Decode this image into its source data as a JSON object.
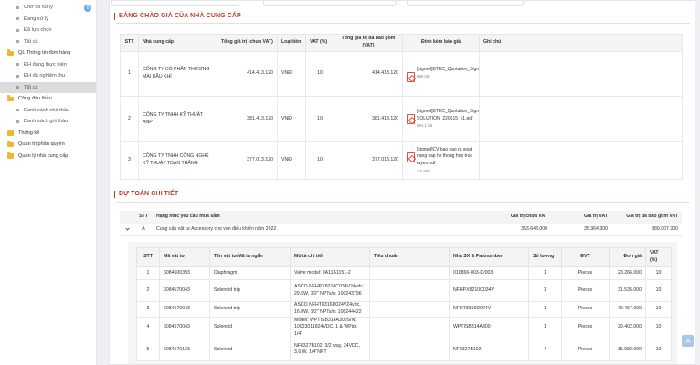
{
  "sidebar": {
    "items": [
      {
        "label": "Chờ tôi xử lý",
        "level": "sub",
        "badge": "0"
      },
      {
        "label": "Đang xử lý",
        "level": "sub"
      },
      {
        "label": "Đã lựa chọn",
        "level": "sub"
      },
      {
        "label": "Tất cả",
        "level": "sub"
      },
      {
        "label": "QL Thông tin đơn hàng",
        "level": "folder"
      },
      {
        "label": "ĐH đang thực hiện",
        "level": "sub"
      },
      {
        "label": "ĐH đã nghiệm thu",
        "level": "sub"
      },
      {
        "label": "Tất cả",
        "level": "sub",
        "active": true
      },
      {
        "label": "Công đấu thầu",
        "level": "folder"
      },
      {
        "label": "Danh sách nhà thầu",
        "level": "sub"
      },
      {
        "label": "Danh sách gói thầu",
        "level": "sub"
      },
      {
        "label": "Thống kê",
        "level": "folder"
      },
      {
        "label": "Quản trị phân quyền",
        "level": "folder"
      },
      {
        "label": "Quản lý nhà cung cấp",
        "level": "folder"
      }
    ]
  },
  "quotes": {
    "title": "BẢNG CHÀO GIÁ CỦA NHÀ CUNG CẤP",
    "headers": [
      "STT",
      "Nhà cung cấp",
      "Tổng giá trị (chưa VAT)",
      "Loại tiền",
      "VAT (%)",
      "Tổng giá trị đã bao gồm (VAT)",
      "Đính kèm báo giá",
      "Ghi chú"
    ],
    "rows": [
      {
        "stt": "1",
        "supplier": "CÔNG TY CỔ PHẦN THƯƠNG MẠI DẦU KHÍ",
        "total": "414.413.120",
        "currency": "VNĐ",
        "vat": "10",
        "total_vat": "414.413.120",
        "file": "[signed]BTEC_Quotation_Signflow_OnPrimes_AEONMALL_220615_v1.pdf",
        "size": "696 kB",
        "note": ""
      },
      {
        "stt": "2",
        "supplier": "CÔNG TY TNHH KỸ THUẬT ANP",
        "total": "381.413.120",
        "currency": "VNĐ",
        "vat": "10",
        "total_vat": "381.413.120",
        "file": "[signed]BTEC_Quotation_Signflow_OnPrimes_GENE SOLUTION_220615_v1.pdf",
        "size": "694.1 kB",
        "note": ""
      },
      {
        "stt": "3",
        "supplier": "CÔNG TY TNHH CÔNG NGHỆ KỸ THUẬT TOÀN THẮNG",
        "total": "377.013.120",
        "currency": "VNĐ",
        "vat": "10",
        "total_vat": "377.013.120",
        "file": "[signed]CV bao cao ra soat nang cap he thong hop truc tuyen.pdf",
        "size": "1.5 MB",
        "note": ""
      }
    ]
  },
  "estimate": {
    "title": "DỰ TOÁN CHI TIẾT",
    "headers": [
      "STT",
      "Hạng mục yêu cầu mua sắm",
      "Giá trị chưa VAT",
      "Giá trị VAT",
      "Giá trị đã bao gồm VAT"
    ],
    "group": {
      "stt": "A",
      "name": "Cung cấp vật tư Accessory cho van điều khiển năm 2022",
      "value": "353.643.000",
      "vat": "35.364.300",
      "total": "389.007.300"
    },
    "item_headers": [
      "STT",
      "Mã vật tư",
      "Tên vật tư/Mã tả ngắn",
      "Mô tả chi tiết",
      "Tiêu chuẩn",
      "Nhà SX & Partnumber",
      "Số lượng",
      "ĐVT",
      "Đơn giá",
      "VAT (%)"
    ],
    "items": [
      {
        "stt": "1",
        "code": "6084500393",
        "name": "Diaphragm",
        "desc": "Valve model: JA11A1151-2",
        "std": "",
        "maker": "010866-003-D/003",
        "qty": "1",
        "unit": "Pieces",
        "price": "23.266.000",
        "vat": "10"
      },
      {
        "stt": "2",
        "code": "6084570043",
        "name": "Solenoid trip",
        "desc": "ASCO NFHPX8210C034V24vdc, 29.5W, 1/2\" NPTs/n: 100243796",
        "std": "",
        "maker": "NFHPX8210C034V",
        "qty": "1",
        "unit": "Pieces",
        "price": "31.535.000",
        "vat": "10"
      },
      {
        "stt": "3",
        "code": "6084570043",
        "name": "Solenoid trip",
        "desc": "ASCO NFHT8316D024V24vdc, 16.8W, 1/2\" NPTs/n: 100244422",
        "std": "",
        "maker": "NFHT8316D024V",
        "qty": "1",
        "unit": "Pieces",
        "price": "49.467.000",
        "vat": "10"
      },
      {
        "stt": "4",
        "code": "6084570043",
        "name": "Solenoid",
        "desc": "Model: WPTISB314A300S/N: 10023011824VDC, 1 & WPipr. 1/4\"",
        "std": "",
        "maker": "WPTISB314A300",
        "qty": "1",
        "unit": "Pieces",
        "price": "29.402.000",
        "vat": "10"
      },
      {
        "stt": "5",
        "code": "6084570133",
        "name": "Solenoid",
        "desc": "NF8327B102, 3/2 way, 24VDC, 3,6 W, 1/4\"NPT",
        "std": "",
        "maker": "NF8327B102",
        "qty": "4",
        "unit": "Pieces",
        "price": "35.982.000",
        "vat": "10"
      }
    ]
  }
}
